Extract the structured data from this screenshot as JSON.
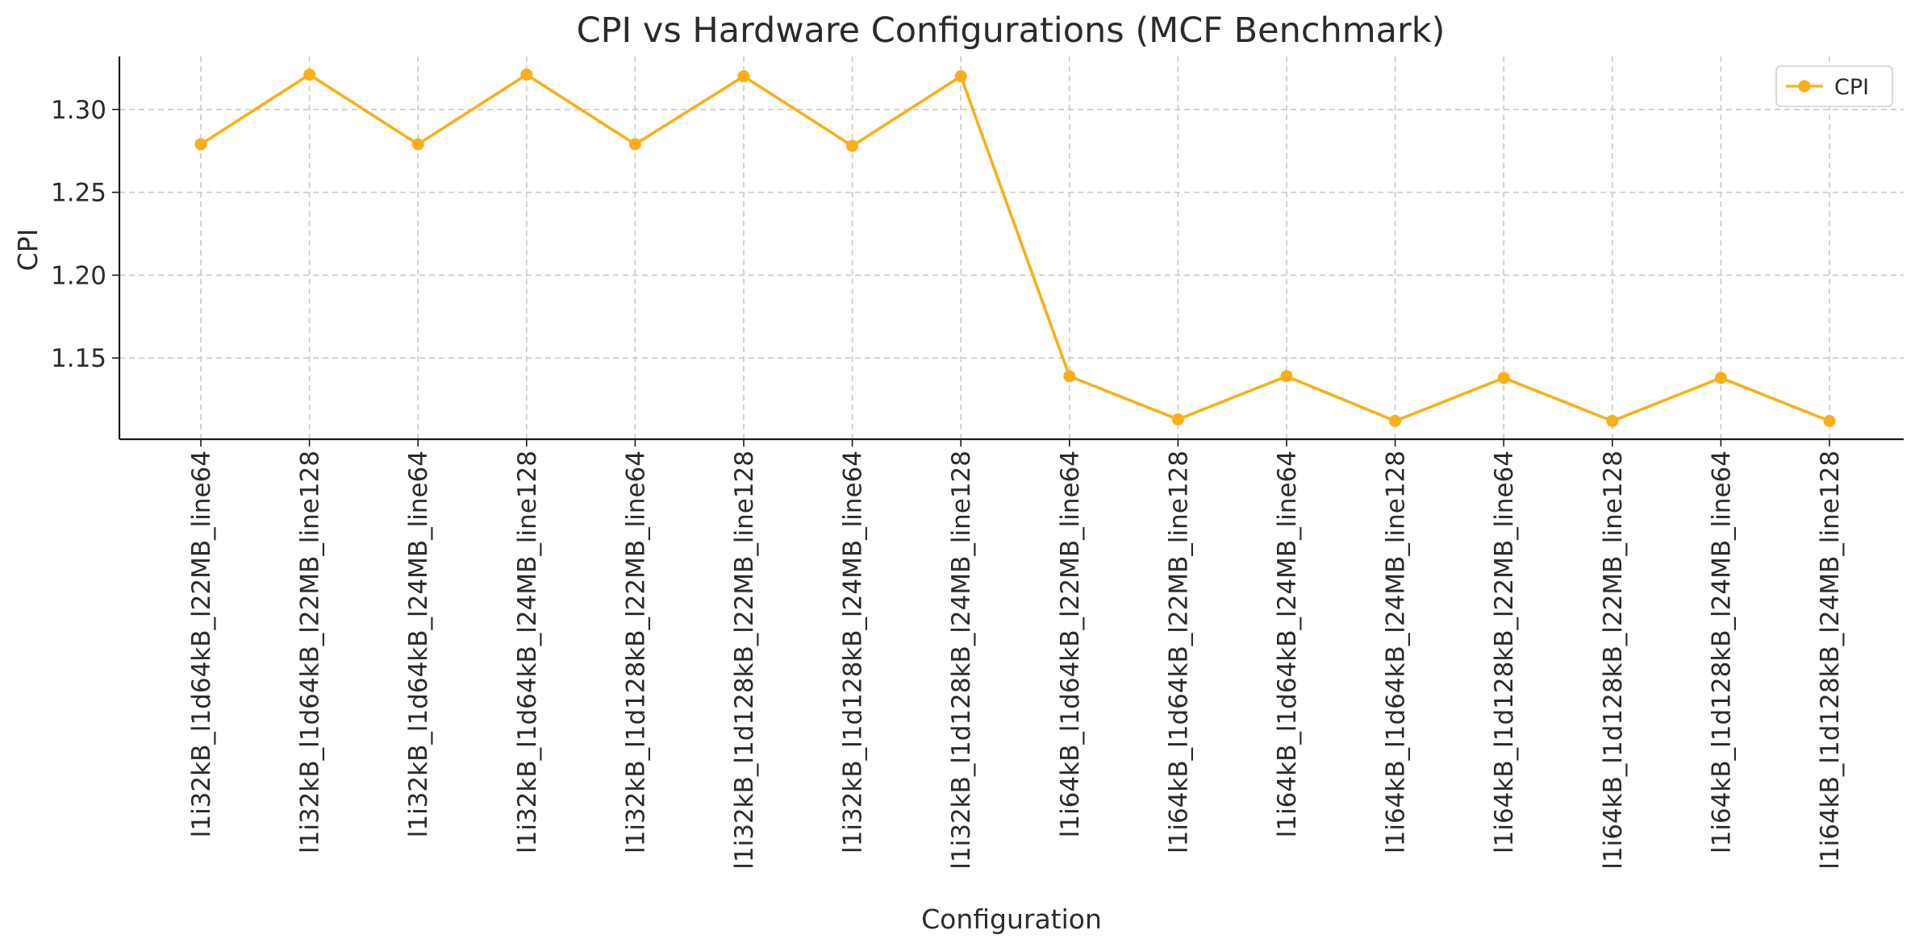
{
  "chart_data": {
    "type": "line",
    "title": "CPI vs Hardware Configurations (MCF Benchmark)",
    "xlabel": "Configuration",
    "ylabel": "CPI",
    "ylim": [
      1.101,
      1.332
    ],
    "yticks": [
      1.15,
      1.2,
      1.25,
      1.3
    ],
    "ytick_labels": [
      "1.15",
      "1.20",
      "1.25",
      "1.30"
    ],
    "grid": true,
    "legend_position": "top-right",
    "categories": [
      "l1i32kB_l1d64kB_l22MB_line64",
      "l1i32kB_l1d64kB_l22MB_line128",
      "l1i32kB_l1d64kB_l24MB_line64",
      "l1i32kB_l1d64kB_l24MB_line128",
      "l1i32kB_l1d128kB_l22MB_line64",
      "l1i32kB_l1d128kB_l22MB_line128",
      "l1i32kB_l1d128kB_l24MB_line64",
      "l1i32kB_l1d128kB_l24MB_line128",
      "l1i64kB_l1d64kB_l22MB_line64",
      "l1i64kB_l1d64kB_l22MB_line128",
      "l1i64kB_l1d64kB_l24MB_line64",
      "l1i64kB_l1d64kB_l24MB_line128",
      "l1i64kB_l1d128kB_l22MB_line64",
      "l1i64kB_l1d128kB_l22MB_line128",
      "l1i64kB_l1d128kB_l24MB_line64",
      "l1i64kB_l1d128kB_l24MB_line128"
    ],
    "series": [
      {
        "name": "CPI",
        "color": "#FBAE17",
        "values": [
          1.279,
          1.321,
          1.279,
          1.321,
          1.279,
          1.32,
          1.278,
          1.32,
          1.139,
          1.113,
          1.139,
          1.112,
          1.138,
          1.112,
          1.138,
          1.112
        ]
      }
    ]
  }
}
